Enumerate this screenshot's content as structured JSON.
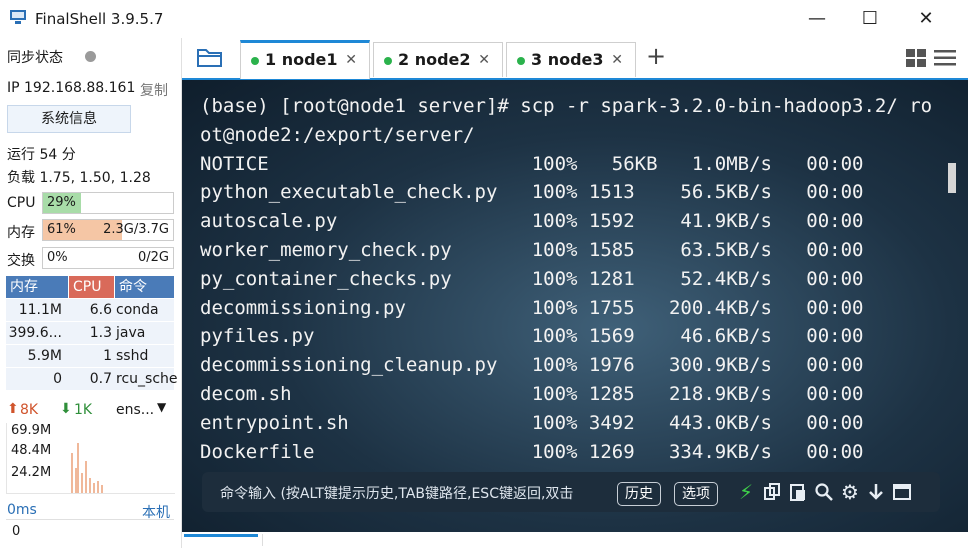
{
  "window": {
    "title": "FinalShell 3.9.5.7",
    "minimize_label": "—",
    "maximize_label": "☐",
    "close_label": "✕"
  },
  "sidebar": {
    "sync_label": "同步状态",
    "ip_label": "IP 192.168.88.161",
    "copy_label": "复制",
    "sysinfo_button": "系统信息",
    "uptime": "运行 54 分",
    "load": "负载 1.75, 1.50, 1.28",
    "cpu": {
      "label": "CPU",
      "value": "29%",
      "percent": 29
    },
    "mem": {
      "label": "内存",
      "value": "61%",
      "detail": "2.3G/3.7G",
      "percent": 61
    },
    "swap": {
      "label": "交换",
      "value": "0%",
      "detail": "0/2G",
      "percent": 0
    },
    "proc_headers": [
      "内存",
      "CPU",
      "命令"
    ],
    "processes": [
      {
        "mem": "11.1M",
        "cpu": "6.6",
        "cmd": "conda"
      },
      {
        "mem": "399.6...",
        "cpu": "1.3",
        "cmd": "java"
      },
      {
        "mem": "5.9M",
        "cpu": "1",
        "cmd": "sshd"
      },
      {
        "mem": "0",
        "cpu": "0.7",
        "cmd": "rcu_sche"
      }
    ],
    "net": {
      "up": "8K",
      "down": "1K",
      "iface": "ens...",
      "levels": [
        "69.9M",
        "48.4M",
        "24.2M"
      ]
    },
    "latency": {
      "value": "0ms",
      "host": "本机",
      "zero": "0"
    }
  },
  "tabs": [
    {
      "label": "1 node1",
      "active": true
    },
    {
      "label": "2 node2",
      "active": false
    },
    {
      "label": "3 node3",
      "active": false
    }
  ],
  "tab_add": "+",
  "terminal": {
    "lines": [
      "(base) [root@node1 server]# scp -r spark-3.2.0-bin-hadoop3.2/ ro",
      "ot@node2:/export/server/",
      "NOTICE                       100%   56KB   1.0MB/s   00:00",
      "python_executable_check.py   100% 1513    56.5KB/s   00:00",
      "autoscale.py                 100% 1592    41.9KB/s   00:00",
      "worker_memory_check.py       100% 1585    63.5KB/s   00:00",
      "py_container_checks.py       100% 1281    52.4KB/s   00:00",
      "decommissioning.py           100% 1755   200.4KB/s   00:00",
      "pyfiles.py                   100% 1569    46.6KB/s   00:00",
      "decommissioning_cleanup.py   100% 1976   300.9KB/s   00:00",
      "decom.sh                     100% 1285   218.9KB/s   00:00",
      "entrypoint.sh                100% 3492   443.0KB/s   00:00",
      "Dockerfile                   100% 1269   334.9KB/s   00:00"
    ]
  },
  "cmdbar": {
    "placeholder": "命令输入 (按ALT键提示历史,TAB键路径,ESC键返回,双击",
    "history_button": "历史",
    "options_button": "选项"
  },
  "colors": {
    "accent": "#1e88d6",
    "active_dot": "#2bb24c",
    "cpu_fill": "#a8dca8",
    "mem_fill": "#f5c6a5",
    "proc_header": "#4a7bb8"
  }
}
